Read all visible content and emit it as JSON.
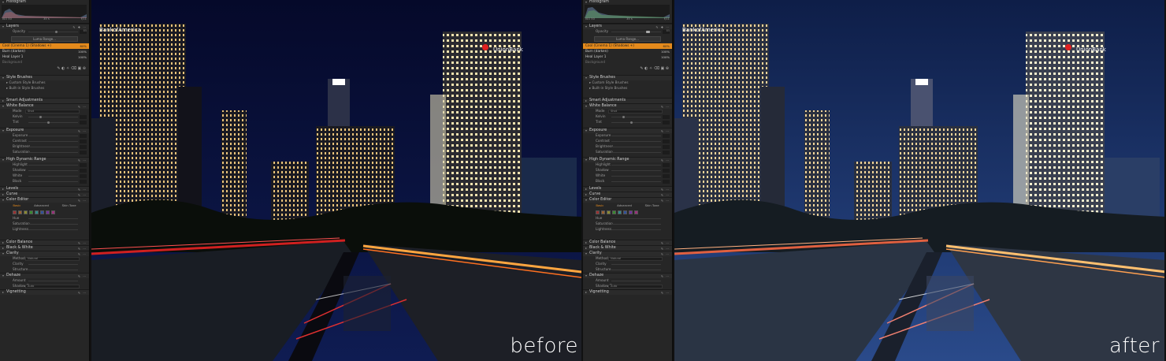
{
  "captions": {
    "before": "before",
    "after": "after"
  },
  "histogram": {
    "title": "Histogram",
    "iso": "ISO 50",
    "focal": "35 s",
    "aperture": "f/11"
  },
  "layers": {
    "title": "Layers",
    "opacity_label": "Opacity",
    "opacity_value": "85",
    "luma_button": "Luma Range...",
    "items": [
      {
        "name": "Cool (Cinema 1) (Shadows +)",
        "pct": "60%"
      },
      {
        "name": "Burn (darken)",
        "pct": "100%"
      },
      {
        "name": "Heal Layer 1",
        "pct": "100%"
      },
      {
        "name": "Background",
        "pct": ""
      }
    ]
  },
  "style_brushes": {
    "title": "Style Brushes",
    "items": [
      "Custom Style Brushes",
      "Built-in Style Brushes"
    ]
  },
  "smart_adjustments": "Smart Adjustments",
  "white_balance": {
    "title": "White Balance",
    "rows": [
      {
        "label": "Mode",
        "value": "Shot"
      },
      {
        "label": "Kelvin",
        "value": ""
      },
      {
        "label": "Tint",
        "value": ""
      }
    ]
  },
  "exposure": {
    "title": "Exposure",
    "rows": [
      "Exposure",
      "Contrast",
      "Brightness",
      "Saturation"
    ]
  },
  "hdr": {
    "title": "High Dynamic Range",
    "rows": [
      "Highlight",
      "Shadow",
      "White",
      "Black"
    ]
  },
  "levels": "Levels",
  "curve": "Curve",
  "color_editor": {
    "title": "Color Editor",
    "tabs": [
      "Basic",
      "Advanced",
      "Skin Tone"
    ],
    "rows": [
      "Hue",
      "Saturation",
      "Lightness"
    ]
  },
  "color_balance": "Color Balance",
  "black_white": "Black & White",
  "clarity": {
    "title": "Clarity",
    "rows": [
      {
        "label": "Method",
        "value": "Natural"
      },
      {
        "label": "Clarity",
        "value": ""
      },
      {
        "label": "Structure",
        "value": ""
      }
    ]
  },
  "dehaze": {
    "title": "Dehaze",
    "rows": [
      {
        "label": "Amount",
        "value": ""
      },
      {
        "label": "Shadow Tone",
        "value": "Auto"
      }
    ]
  },
  "vignetting": "Vignetting",
  "signs": {
    "left": "BankofAmerica",
    "right": "UnionBank"
  },
  "colors": {
    "accent": "#e48a1c",
    "panel": "#262626",
    "sky_before": "#0b1440",
    "sky_after": "#1a3a78"
  }
}
